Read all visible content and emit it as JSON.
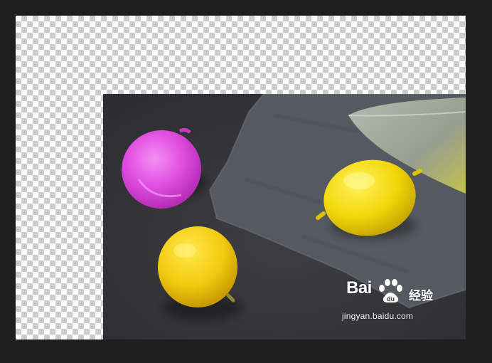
{
  "watermark": {
    "brand": "Bai",
    "brand_cn": "经验",
    "url": "jingyan.baidu.com"
  },
  "colors": {
    "workspace": "#1e1e1e",
    "background_table": "#38383c",
    "slate": "#555a60",
    "magenta_lemon": "#e04de0",
    "yellow_lemon": "#f1d000"
  },
  "icons": [
    "baidu-paw-icon"
  ]
}
